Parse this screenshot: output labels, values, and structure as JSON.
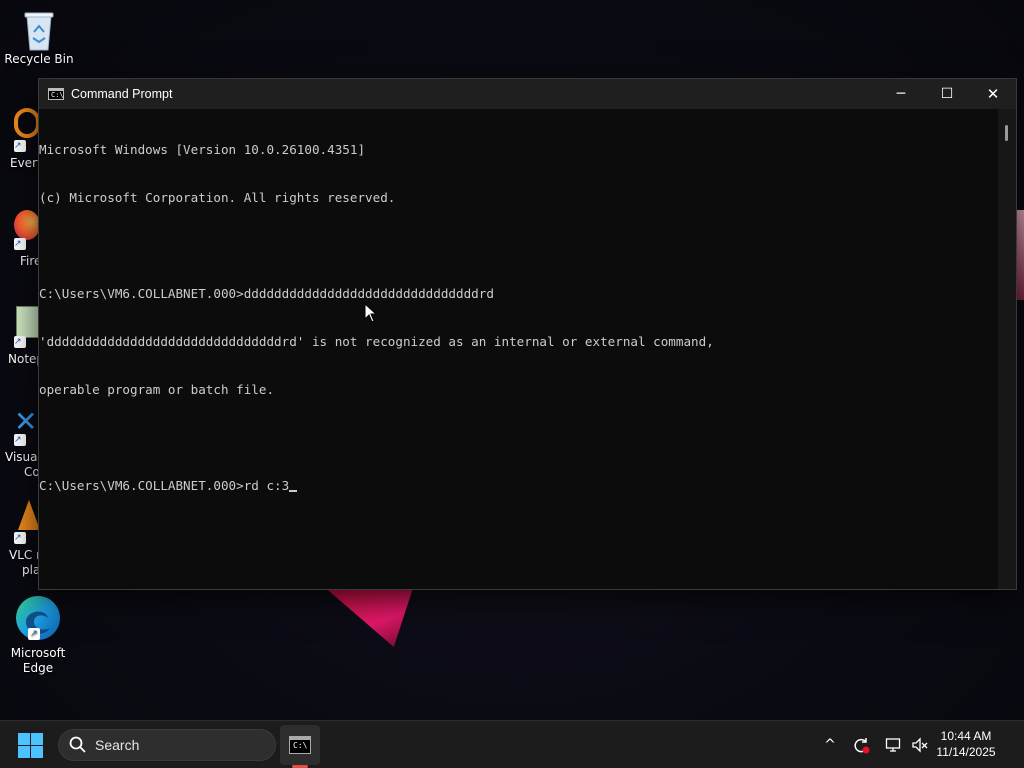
{
  "desktop": {
    "icons": [
      {
        "label": "Recycle Bin"
      },
      {
        "label": "Every"
      },
      {
        "label": "Fire"
      },
      {
        "label": "Notep"
      },
      {
        "label_line1": "Visual",
        "label_line2": "Co"
      },
      {
        "label_line1": "VLC n",
        "label_line2": "pla"
      },
      {
        "label_line1": "Microsoft",
        "label_line2": "Edge"
      }
    ]
  },
  "window": {
    "title": "Command Prompt",
    "controls": {
      "minimize": "─",
      "maximize": "☐",
      "close": "✕"
    },
    "lines": [
      "Microsoft Windows [Version 10.0.26100.4351]",
      "(c) Microsoft Corporation. All rights reserved.",
      "",
      "C:\\Users\\VM6.COLLABNET.000>dddddddddddddddddddddddddddddddrd",
      "'dddddddddddddddddddddddddddddddrd' is not recognized as an internal or external command,",
      "operable program or batch file.",
      "",
      "C:\\Users\\VM6.COLLABNET.000>rd c:3"
    ]
  },
  "taskbar": {
    "search_placeholder": "Search",
    "tray": {
      "chevron": "^"
    },
    "clock": {
      "time": "10:44 AM",
      "date": "11/14/2025"
    }
  },
  "colors": {
    "console_bg": "#0c0c0c",
    "console_text": "#cccccc",
    "accent": "#4cc2ff",
    "taskbar_bg": "#1c1c1c"
  }
}
